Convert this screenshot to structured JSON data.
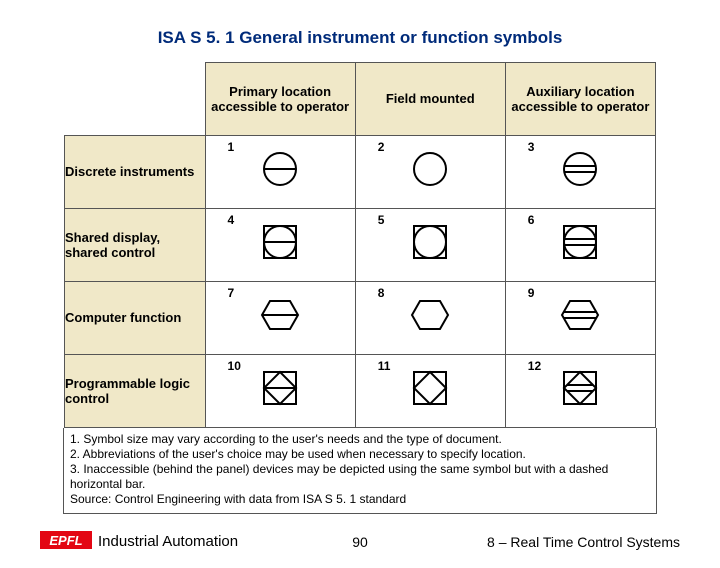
{
  "title": "ISA S 5. 1 General instrument or function symbols",
  "columns": {
    "c1": "Primary location accessible to operator",
    "c2": "Field mounted",
    "c3": "Auxiliary location accessible to operator"
  },
  "rows": {
    "r1": "Discrete instruments",
    "r2": "Shared display, shared control",
    "r3": "Computer function",
    "r4": "Programmable logic control"
  },
  "cellnums": {
    "n1": "1",
    "n2": "2",
    "n3": "3",
    "n4": "4",
    "n5": "5",
    "n6": "6",
    "n7": "7",
    "n8": "8",
    "n9": "9",
    "n10": "10",
    "n11": "11",
    "n12": "12"
  },
  "notes": {
    "l1": "1. Symbol size may vary according to the user's needs and the type of document.",
    "l2": "2. Abbreviations of the user's choice may be used when necessary to specify location.",
    "l3": "3. Inaccessible (behind the panel) devices may be depicted using the same symbol but with a dashed horizontal bar.",
    "l4": "Source: Control Engineering with data from ISA S 5. 1 standard"
  },
  "footer": {
    "left": "Industrial Automation",
    "center": "90",
    "right": "8 – Real Time Control Systems"
  }
}
